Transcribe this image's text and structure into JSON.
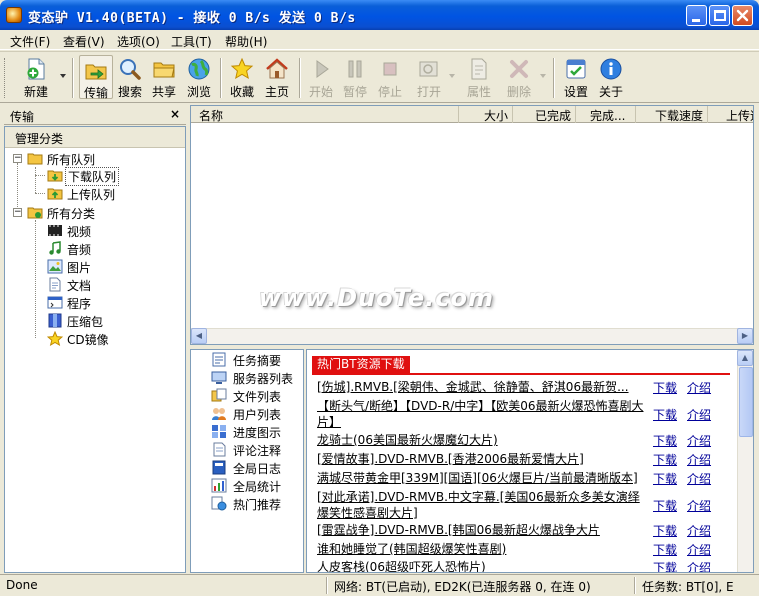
{
  "window": {
    "title": "变态驴 V1.40(BETA) - 接收 0 B/s 发送 0 B/s"
  },
  "menu": [
    "文件(F)",
    "查看(V)",
    "选项(O)",
    "工具(T)",
    "帮助(H)"
  ],
  "toolbar": {
    "new": "新建",
    "transfer": "传输",
    "search": "搜索",
    "share": "共享",
    "browse": "浏览",
    "favorites": "收藏",
    "home": "主页",
    "start": "开始",
    "pause": "暂停",
    "stop": "停止",
    "open": "打开",
    "properties": "属性",
    "delete": "删除",
    "settings": "设置",
    "about": "关于"
  },
  "left_panel": {
    "header": "传输",
    "close": "×",
    "title": "管理分类",
    "tree": {
      "all_queues": "所有队列",
      "download_queue": "下载队列",
      "upload_queue": "上传队列",
      "all_categories": "所有分类",
      "video": "视频",
      "audio": "音频",
      "image": "图片",
      "document": "文档",
      "program": "程序",
      "archive": "压缩包",
      "cd_image": "CD镜像"
    }
  },
  "file_list": {
    "columns": [
      "名称",
      "大小",
      "已完成",
      "完成...",
      "下载速度",
      "上传速"
    ],
    "watermark": "www.DuoTe.com"
  },
  "nav": [
    "任务摘要",
    "服务器列表",
    "文件列表",
    "用户列表",
    "进度图示",
    "评论注释",
    "全局日志",
    "全局统计",
    "热门推荐"
  ],
  "bt": {
    "tab": "热门BT资源下载",
    "download_label": "下载",
    "intro_label": "介绍",
    "items": [
      "[伤城].RMVB.[梁朝伟、金城武、徐静蕾、舒淇06最新贺...",
      "【断头气/断绝】【DVD-R/中字】【欧美06最新火爆恐怖喜剧大片】",
      "龙骑士(06美国最新火爆魔幻大片)",
      "[爱情故事].DVD-RMVB.[香港2006最新爱情大片]",
      "满城尽带黄金甲[339M][国语][06火爆巨片/当前最清晰版本]",
      "[对此承诺].DVD-RMVB.中文字幕.[美国06最新众多美女演绎爆笑性感喜剧大片]",
      "[雷霆战争].DVD-RMVB.[韩国06最新超火爆战争大片",
      "谁和她睡觉了(韩国超级爆笑性喜剧)",
      "人皮客栈(06超级吓死人恐怖片)"
    ]
  },
  "status": {
    "left": "Done",
    "network": "网络: BT(已启动), ED2K(已连服务器 0, 在连 0)",
    "tasks": "任务数: BT[0], E"
  },
  "colors": {
    "titlebar": "#0054e3",
    "bt_accent": "#e01010",
    "link": "#000099"
  }
}
